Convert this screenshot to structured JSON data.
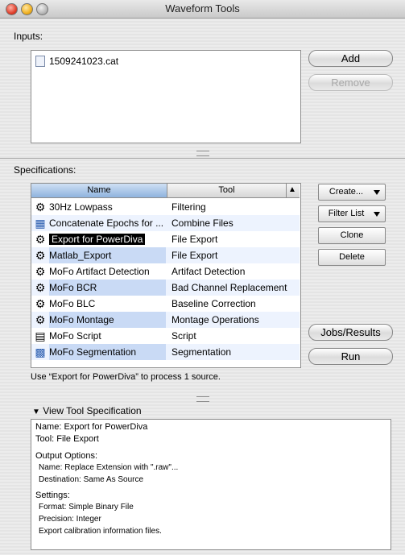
{
  "window": {
    "title": "Waveform Tools"
  },
  "inputs": {
    "label": "Inputs:",
    "files": [
      {
        "name": "1509241023.cat"
      }
    ],
    "add_label": "Add",
    "remove_label": "Remove"
  },
  "specifications": {
    "label": "Specifications:",
    "columns": {
      "name": "Name",
      "tool": "Tool"
    },
    "rows": [
      {
        "name": "30Hz Lowpass",
        "tool": "Filtering",
        "icon": "gear-icon"
      },
      {
        "name": "Concatenate Epochs for ...",
        "tool": "Combine Files",
        "icon": "concatenate-icon"
      },
      {
        "name": "Export for PowerDiva",
        "tool": "File Export",
        "icon": "gear-icon"
      },
      {
        "name": "Matlab_Export",
        "tool": "File Export",
        "icon": "gear-icon"
      },
      {
        "name": "MoFo Artifact Detection",
        "tool": "Artifact Detection",
        "icon": "gear-icon"
      },
      {
        "name": "MoFo BCR",
        "tool": "Bad Channel Replacement",
        "icon": "gear-icon"
      },
      {
        "name": "MoFo BLC",
        "tool": "Baseline Correction",
        "icon": "gear-icon"
      },
      {
        "name": "MoFo Montage",
        "tool": "Montage Operations",
        "icon": "gear-icon"
      },
      {
        "name": "MoFo Script",
        "tool": "Script",
        "icon": "script-icon"
      },
      {
        "name": "MoFo Segmentation",
        "tool": "Segmentation",
        "icon": "segmentation-icon"
      }
    ],
    "selected_index": 2,
    "create_label": "Create...",
    "filter_label": "Filter List",
    "clone_label": "Clone",
    "delete_label": "Delete",
    "jobs_label": "Jobs/Results",
    "run_label": "Run",
    "status": "Use “Export for PowerDiva” to process 1 source."
  },
  "view_spec": {
    "toggle_label": "View Tool Specification",
    "lines": {
      "name": "Name: Export for PowerDiva",
      "tool": "Tool: File Export",
      "output_heading": "Output Options:",
      "output_name": "Name: Replace Extension with \".raw\"...",
      "destination": "Destination: Same As Source",
      "settings_heading": "Settings:",
      "format": "Format: Simple Binary File",
      "precision": "Precision: Integer",
      "calibration": "Export calibration information files."
    }
  }
}
